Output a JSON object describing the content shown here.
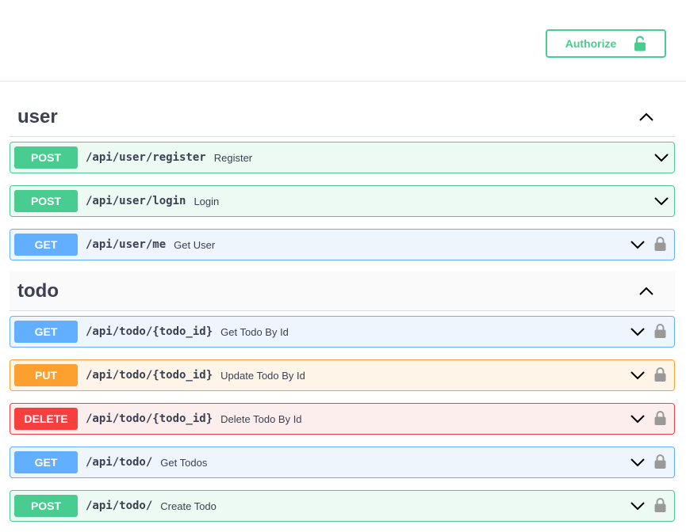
{
  "header": {
    "authorize_label": "Authorize"
  },
  "sections": [
    {
      "title": "user",
      "operations": [
        {
          "method": "POST",
          "path": "/api/user/register",
          "summary": "Register",
          "locked": false
        },
        {
          "method": "POST",
          "path": "/api/user/login",
          "summary": "Login",
          "locked": false
        },
        {
          "method": "GET",
          "path": "/api/user/me",
          "summary": "Get User",
          "locked": true
        }
      ]
    },
    {
      "title": "todo",
      "operations": [
        {
          "method": "GET",
          "path": "/api/todo/{todo_id}",
          "summary": "Get Todo By Id",
          "locked": true
        },
        {
          "method": "PUT",
          "path": "/api/todo/{todo_id}",
          "summary": "Update Todo By Id",
          "locked": true
        },
        {
          "method": "DELETE",
          "path": "/api/todo/{todo_id}",
          "summary": "Delete Todo By Id",
          "locked": true
        },
        {
          "method": "GET",
          "path": "/api/todo/",
          "summary": "Get Todos",
          "locked": true
        },
        {
          "method": "POST",
          "path": "/api/todo/",
          "summary": "Create Todo",
          "locked": true
        }
      ]
    }
  ],
  "colors": {
    "post": "#49cc90",
    "get": "#61affe",
    "put": "#fca130",
    "delete": "#f93e3e",
    "text": "#3b4151"
  },
  "icons": {
    "authorize": "unlock-icon",
    "section_toggle": "chevron-up-icon",
    "operation_toggle": "chevron-down-icon",
    "operation_lock": "lock-icon"
  }
}
